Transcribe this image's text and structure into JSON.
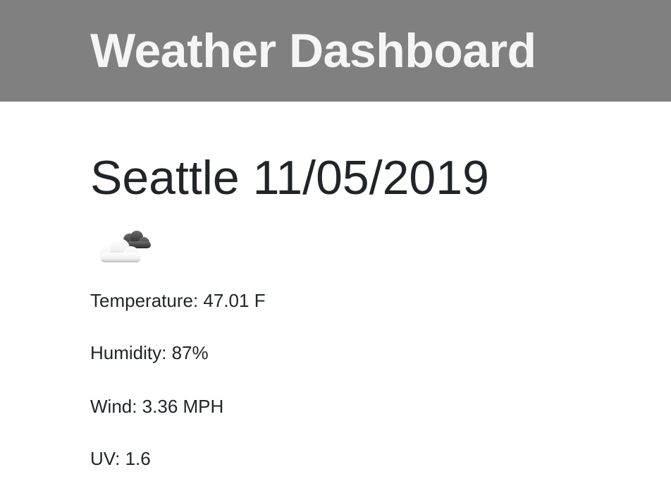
{
  "header": {
    "title": "Weather Dashboard",
    "background_color": "#808080"
  },
  "current": {
    "heading": "Seattle 11/05/2019",
    "icon": "partly-cloudy-icon",
    "temperature": "Temperature: 47.01 F",
    "humidity": "Humidity: 87%",
    "wind": "Wind: 3.36 MPH",
    "uv": "UV: 1.6"
  }
}
